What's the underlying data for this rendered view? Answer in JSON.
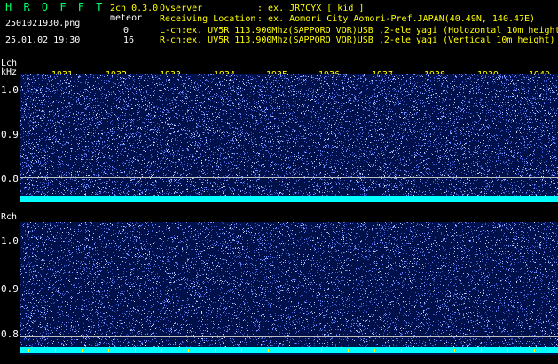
{
  "header": {
    "app_title": "H R O F F T",
    "version": "2ch 0.3.0",
    "filename": "2501021930.png",
    "meteor_label": "meteor",
    "datetime": "25.01.02 19:30",
    "meteor_count_l": "0",
    "meteor_count_r": "16"
  },
  "info": {
    "observer_key": "Ovserver",
    "observer_value": ": ex. JR7CYX [ kid ]",
    "location_key": "Receiving Location",
    "location_value": ": ex. Aomori City Aomori-Pref.JAPAN(40.49N, 140.47E)",
    "lch": "L-ch:ex. UV5R 113.900Mhz(SAPPORO VOR)USB ,2-ele yagi (Holozontal 10m height",
    "rch": "R-ch:ex. UV5R 113.900Mhz(SAPPORO VOR)USB ,2-ele yagi (Vertical 10m height)"
  },
  "lch_panel": {
    "channel_label": "Lch",
    "unit_label": "kHz",
    "y_labels": [
      "1.0",
      "0.9",
      "0.8"
    ]
  },
  "rch_panel": {
    "channel_label": "Rch",
    "y_labels": [
      "1.0",
      "0.9",
      "0.8"
    ]
  },
  "time_labels": [
    "1931",
    "1932",
    "1933",
    "1934",
    "1935",
    "1936",
    "1937",
    "1938",
    "1939",
    "1940"
  ],
  "colors": {
    "background": "#000000",
    "spectrogram_bg": "#00104a",
    "noise_dot": "#6f8fff",
    "carrier_band": "#00ffff",
    "title": "#00ff66",
    "info_text": "#ffff00",
    "label_text": "#ffffff"
  }
}
